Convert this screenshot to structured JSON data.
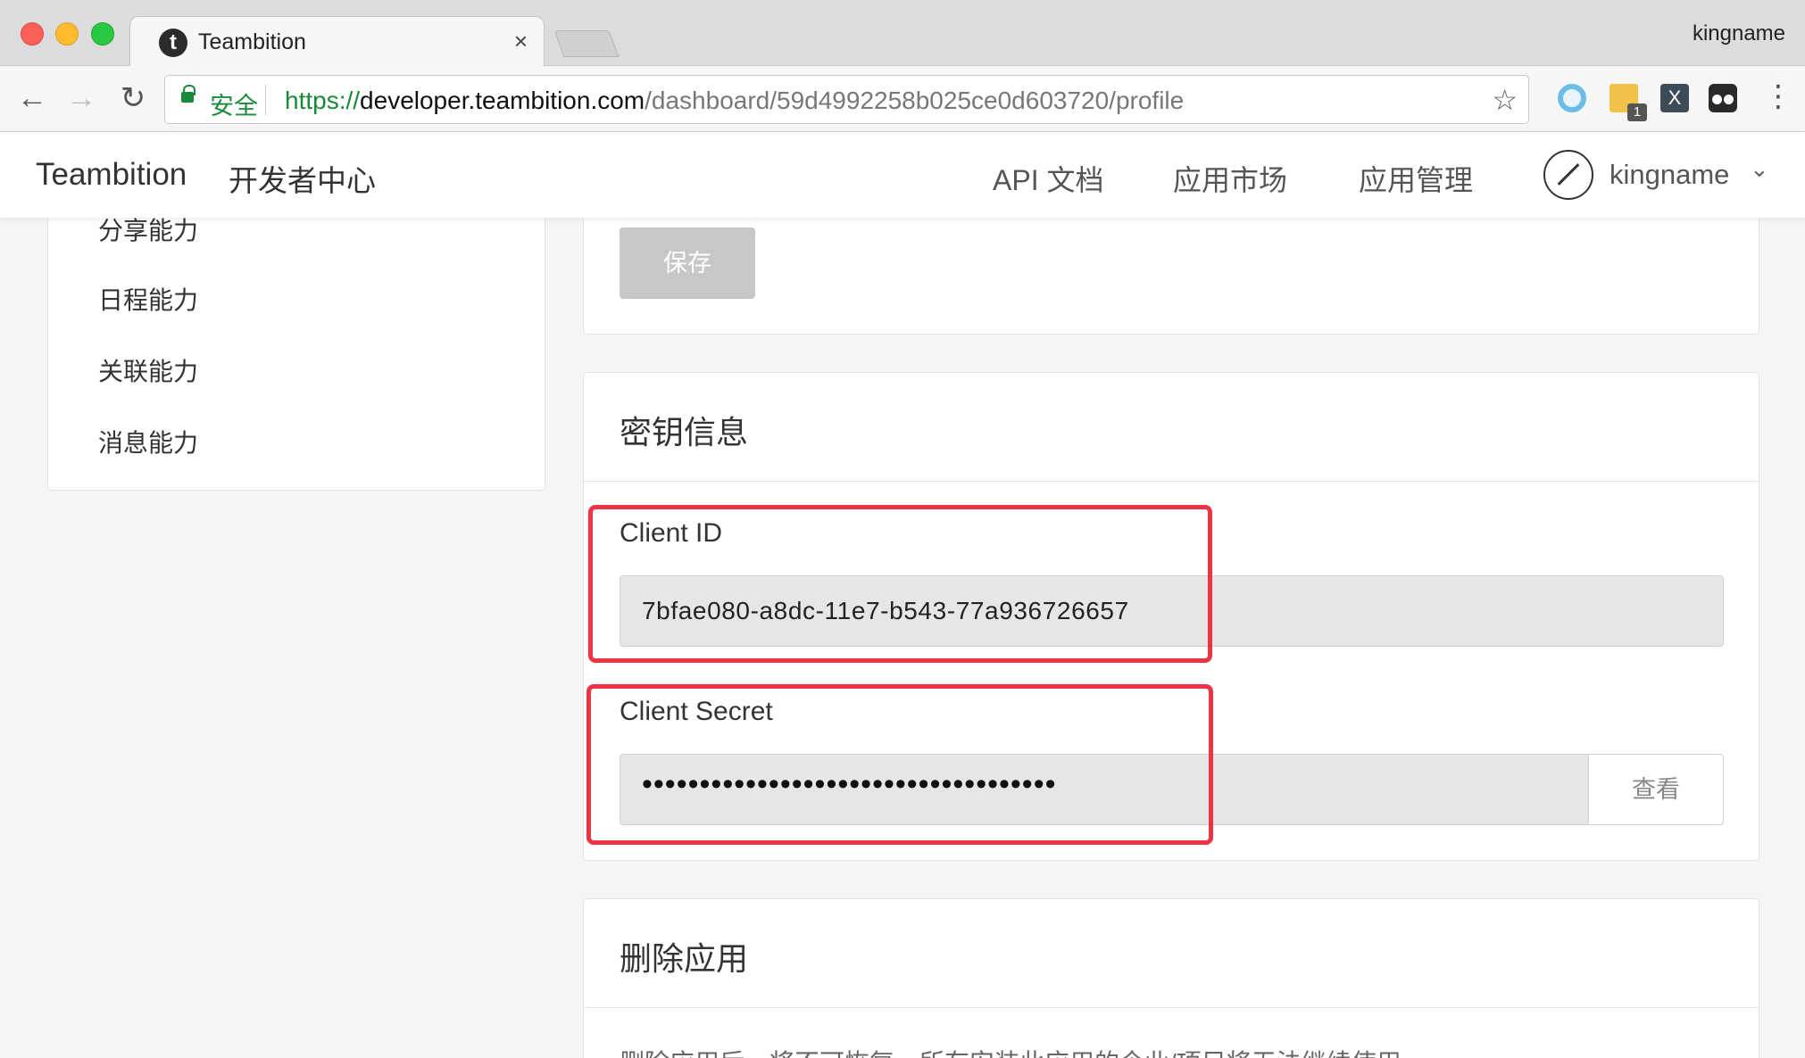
{
  "browser": {
    "tab_title": "Teambition",
    "tab_favicon_letter": "t",
    "tab_close": "×",
    "profile_name": "kingname",
    "secure_label": "安全",
    "url": {
      "scheme": "https://",
      "host": "developer.teambition.com",
      "path": "/dashboard/59d4992258b025ce0d603720/profile"
    },
    "nav_icons": [
      "back-icon",
      "forward-icon",
      "reload-icon"
    ],
    "extensions": [
      "ring-extension-icon",
      "ruler-extension-icon",
      "x-extension-icon",
      "glasses-extension-icon"
    ],
    "extension_badge": "1",
    "extension_x_label": "X"
  },
  "site_header": {
    "brand": "Teambition",
    "brand_sub": "开发者中心",
    "nav": {
      "api_docs": "API 文档",
      "market": "应用市场",
      "manage": "应用管理"
    },
    "user_name": "kingname"
  },
  "sidebar": {
    "items": [
      "分享能力",
      "日程能力",
      "关联能力",
      "消息能力"
    ]
  },
  "top_card": {
    "save_label": "保存"
  },
  "keys_card": {
    "title": "密钥信息",
    "client_id_label": "Client ID",
    "client_id_value": "7bfae080-a8dc-11e7-b543-77a936726657",
    "client_secret_label": "Client Secret",
    "client_secret_value": "••••••••••••••••••••••••••••••••••••",
    "view_label": "查看"
  },
  "delete_card": {
    "title": "删除应用",
    "description": "删除应用后，将不可恢复，所有安装此应用的企业/项目将无法继续使用"
  },
  "colors": {
    "secure_green": "#1a8a3a",
    "highlight_red": "#ee3344",
    "disabled_button": "#c7c7c7"
  }
}
